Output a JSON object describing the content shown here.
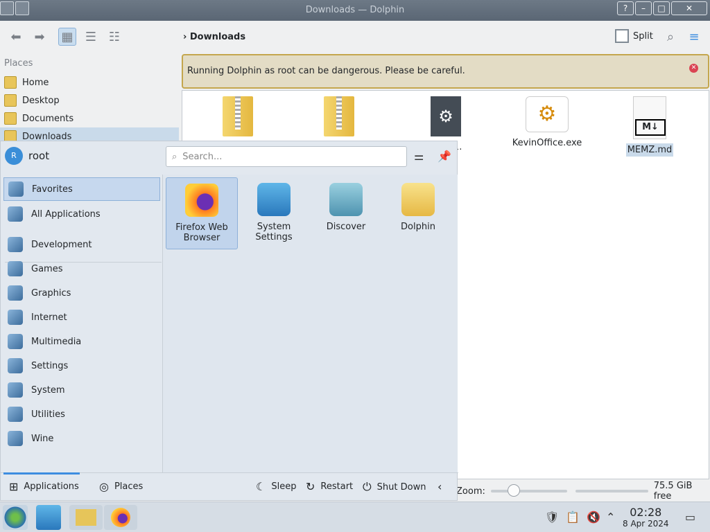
{
  "window": {
    "title": "Downloads — Dolphin",
    "buttons": [
      "?",
      "–",
      "□",
      "✕"
    ]
  },
  "toolbar": {
    "breadcrumb": "Downloads",
    "split_label": "Split"
  },
  "places": {
    "title": "Places",
    "items": [
      "Home",
      "Desktop",
      "Documents",
      "Downloads"
    ]
  },
  "warning": {
    "text": "Running Dolphin as root can be dangerous. Please be careful."
  },
  "files": [
    {
      "name": ""
    },
    {
      "name": ""
    },
    {
      "name": "etup-1."
    },
    {
      "name": "KevinOffice.exe"
    },
    {
      "name": "MEMZ.md"
    }
  ],
  "status": {
    "zoom_label": "Zoom:",
    "free": "75.5 GiB free"
  },
  "launcher": {
    "user": "root",
    "avatar_letter": "R",
    "search_placeholder": "Search...",
    "categories": [
      "Favorites",
      "All Applications",
      "Development",
      "Games",
      "Graphics",
      "Internet",
      "Multimedia",
      "Settings",
      "System",
      "Utilities",
      "Wine"
    ],
    "apps": [
      "Firefox Web Browser",
      "System Settings",
      "Discover",
      "Dolphin"
    ],
    "footer": {
      "applications": "Applications",
      "places": "Places",
      "sleep": "Sleep",
      "restart": "Restart",
      "shutdown": "Shut Down"
    }
  },
  "clock": {
    "time": "02:28",
    "date": "8 Apr 2024"
  },
  "colors": {
    "accent": "#3d8de0",
    "selection": "#c9daea",
    "warning_border": "#c4a64d"
  }
}
